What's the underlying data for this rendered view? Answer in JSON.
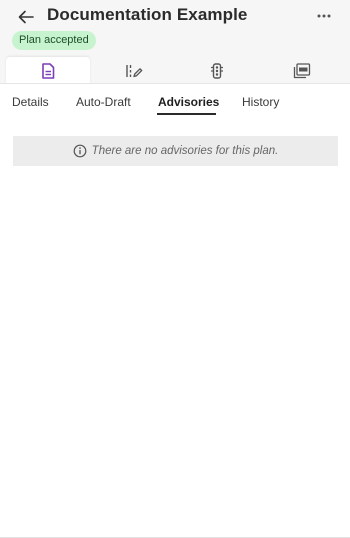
{
  "header": {
    "title": "Documentation Example",
    "status": "Plan accepted"
  },
  "icon_tabs": [
    {
      "icon": "document-icon",
      "active": true
    },
    {
      "icon": "draft-edit-icon",
      "active": false
    },
    {
      "icon": "traffic-light-icon",
      "active": false
    },
    {
      "icon": "pdf-icon",
      "active": false
    }
  ],
  "tabs": [
    "Details",
    "Auto-Draft",
    "Advisories",
    "History"
  ],
  "active_tab": "Advisories",
  "advisories": {
    "empty_message": "There are no advisories for this plan."
  },
  "colors": {
    "accent": "#7b3fb8",
    "badge_bg": "#c8f3cf",
    "badge_text": "#1d4f26"
  }
}
